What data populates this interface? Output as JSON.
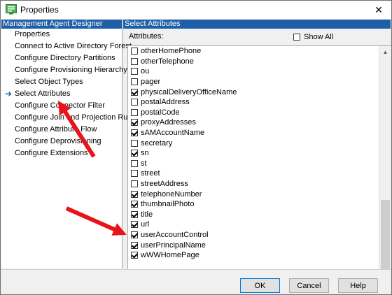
{
  "window": {
    "title": "Properties"
  },
  "left": {
    "header": "Management Agent Designer",
    "items": [
      {
        "label": "Properties"
      },
      {
        "label": "Connect to Active Directory Forest"
      },
      {
        "label": "Configure Directory Partitions"
      },
      {
        "label": "Configure Provisioning Hierarchy"
      },
      {
        "label": "Select Object Types"
      },
      {
        "label": "Select Attributes",
        "selected": true
      },
      {
        "label": "Configure Connector Filter"
      },
      {
        "label": "Configure Join and Projection Rules"
      },
      {
        "label": "Configure Attribute Flow"
      },
      {
        "label": "Configure Deprovisioning"
      },
      {
        "label": "Configure Extensions"
      }
    ]
  },
  "right": {
    "header": "Select Attributes",
    "attributes_label": "Attributes:",
    "show_all_label": "Show All",
    "show_all_checked": false,
    "attributes": [
      {
        "name": "otherHomePhone",
        "checked": false
      },
      {
        "name": "otherTelephone",
        "checked": false
      },
      {
        "name": "ou",
        "checked": false
      },
      {
        "name": "pager",
        "checked": false
      },
      {
        "name": "physicalDeliveryOfficeName",
        "checked": true
      },
      {
        "name": "postalAddress",
        "checked": false
      },
      {
        "name": "postalCode",
        "checked": false
      },
      {
        "name": "proxyAddresses",
        "checked": true
      },
      {
        "name": "sAMAccountName",
        "checked": true
      },
      {
        "name": "secretary",
        "checked": false
      },
      {
        "name": "sn",
        "checked": true
      },
      {
        "name": "st",
        "checked": false
      },
      {
        "name": "street",
        "checked": false
      },
      {
        "name": "streetAddress",
        "checked": false
      },
      {
        "name": "telephoneNumber",
        "checked": true
      },
      {
        "name": "thumbnailPhoto",
        "checked": true
      },
      {
        "name": "title",
        "checked": true
      },
      {
        "name": "url",
        "checked": true
      },
      {
        "name": "userAccountControl",
        "checked": true
      },
      {
        "name": "userPrincipalName",
        "checked": true
      },
      {
        "name": "wWWHomePage",
        "checked": true
      }
    ]
  },
  "buttons": {
    "ok": "OK",
    "cancel": "Cancel",
    "help": "Help"
  },
  "colors": {
    "header_bg": "#1f5fa8",
    "arrow": "#e8141b"
  },
  "icons": {
    "app": "properties-app-icon",
    "close": "close-icon",
    "selected_marker": "arrow-right-icon"
  }
}
